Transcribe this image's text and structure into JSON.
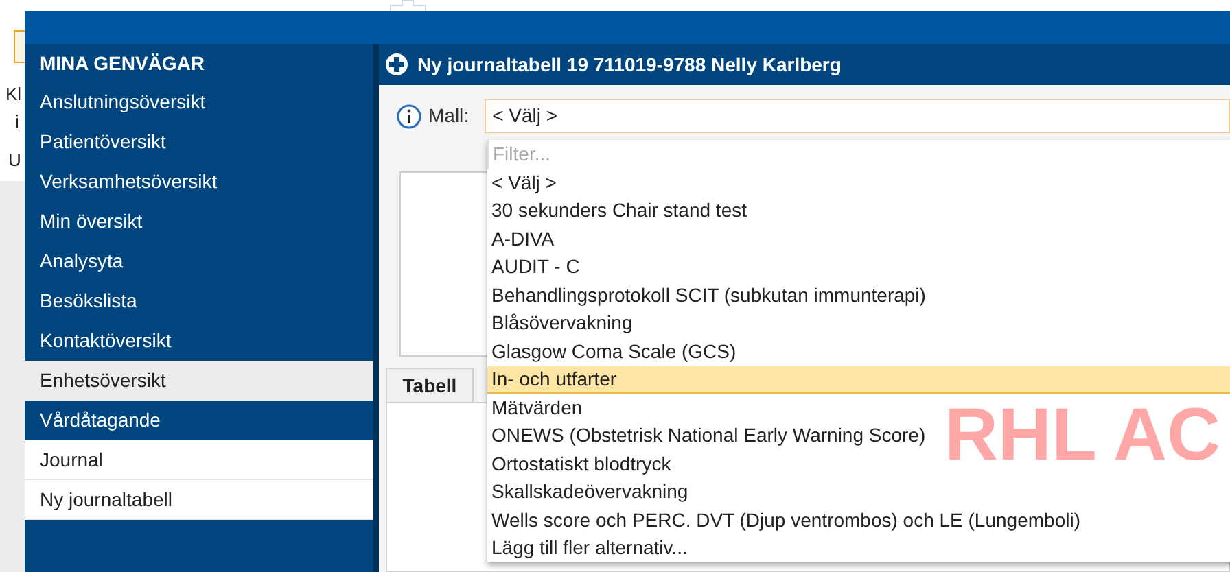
{
  "background_page": {
    "fragments": [
      "Kl",
      "i",
      "U"
    ]
  },
  "sidebar": {
    "title": "MINA GENVÄGAR",
    "items": [
      {
        "label": "Anslutningsöversikt",
        "hovered": false,
        "selected": false
      },
      {
        "label": "Patientöversikt",
        "hovered": false,
        "selected": false
      },
      {
        "label": "Verksamhetsöversikt",
        "hovered": false,
        "selected": false
      },
      {
        "label": "Min översikt",
        "hovered": false,
        "selected": false
      },
      {
        "label": "Analysyta",
        "hovered": false,
        "selected": false
      },
      {
        "label": "Besökslista",
        "hovered": false,
        "selected": false
      },
      {
        "label": "Kontaktöversikt",
        "hovered": false,
        "selected": false
      },
      {
        "label": "Enhetsöversikt",
        "hovered": true,
        "selected": false
      },
      {
        "label": "Vårdåtagande",
        "hovered": false,
        "selected": false
      },
      {
        "label": "Journal",
        "hovered": false,
        "selected": true
      },
      {
        "label": "Ny journaltabell",
        "hovered": false,
        "selected": true
      }
    ]
  },
  "main": {
    "title": "Ny journaltabell 19 711019-9788 Nelly Karlberg",
    "template_field": {
      "label": "Mall:",
      "value": "< Välj >"
    },
    "dropdown": {
      "filter": {
        "placeholder": "Filter..."
      },
      "options": [
        {
          "label": "< Välj >",
          "selected": false
        },
        {
          "label": "30 sekunders Chair stand test",
          "selected": false
        },
        {
          "label": "A-DIVA",
          "selected": false
        },
        {
          "label": "AUDIT - C",
          "selected": false
        },
        {
          "label": "Behandlingsprotokoll SCIT (subkutan immunterapi)",
          "selected": false
        },
        {
          "label": "Blåsövervakning",
          "selected": false
        },
        {
          "label": "Glasgow Coma Scale (GCS)",
          "selected": false
        },
        {
          "label": "In- och utfarter",
          "selected": true
        },
        {
          "label": "Mätvärden",
          "selected": false
        },
        {
          "label": "ONEWS (Obstetrisk National Early Warning Score)",
          "selected": false
        },
        {
          "label": "Ortostatiskt blodtryck",
          "selected": false
        },
        {
          "label": "Skallskadeövervakning",
          "selected": false
        },
        {
          "label": "Wells score och PERC. DVT (Djup ventrombos) och LE (Lungemboli)",
          "selected": false
        },
        {
          "label": "Lägg till fler alternativ...",
          "selected": false
        }
      ]
    },
    "tabs": [
      {
        "label": "Tabell",
        "selected": true
      }
    ],
    "environment_label": "RHL AC"
  }
}
